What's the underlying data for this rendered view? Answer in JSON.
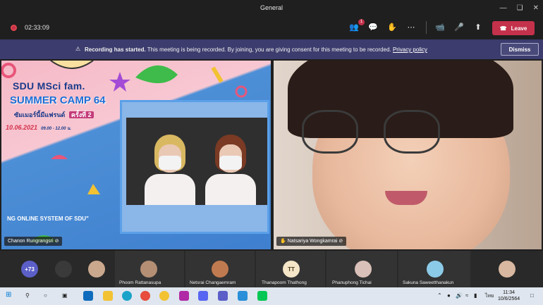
{
  "window": {
    "title": "General"
  },
  "toolbar": {
    "timer": "02:33:09",
    "leave_label": "Leave",
    "badge_count": "1"
  },
  "banner": {
    "bold": "Recording has started.",
    "text": "This meeting is being recorded. By joining, you are giving consent for this meeting to be recorded.",
    "link": "Privacy policy",
    "dismiss": "Dismiss"
  },
  "stage": {
    "left": {
      "name": "Chanon Rungrangsri",
      "poster_title": "SDU MSci fam.",
      "poster_sub": "SUMMER CAMP 64",
      "poster_round": "ครั้งที่ 2",
      "poster_thai": "ซัมเมอร์นี้มีแฟรนด์",
      "poster_date": "10.06.2021",
      "poster_time": "09.00 - 12.00 น.",
      "poster_bottom": "NG ONLINE SYSTEM OF SDU\""
    },
    "right": {
      "name": "Natsariya Wongkamrai"
    }
  },
  "strip": {
    "overflow": "+73",
    "participants": [
      {
        "name": "Phoom Rattanasupa"
      },
      {
        "name": "Netsrai Changaemram"
      },
      {
        "name": "Thanapoom Thathong",
        "initials": "TT"
      },
      {
        "name": "Phanuphong Tichai"
      },
      {
        "name": "Sakuna Saweetthanakun"
      }
    ]
  },
  "taskbar": {
    "time": "11:34",
    "date": "10/6/2564",
    "lang": "ไทย"
  },
  "colors": {
    "accent": "#c4314b",
    "banner": "#3c3c6e"
  }
}
